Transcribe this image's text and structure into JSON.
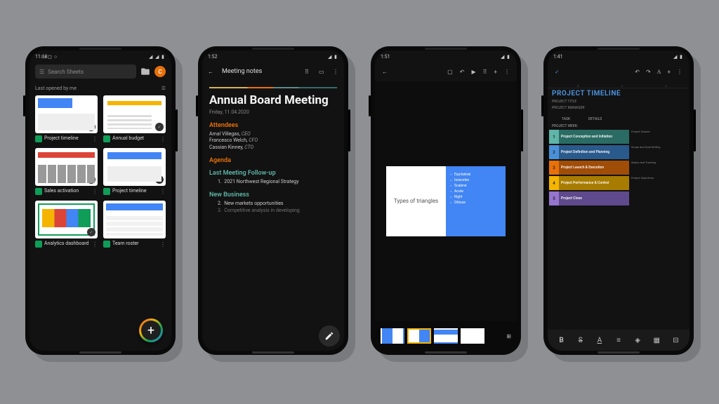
{
  "phone1": {
    "time": "11:18",
    "search_placeholder": "Search Sheets",
    "avatar_letter": "C",
    "sort_label": "Last opened by me",
    "files": [
      {
        "name": "Project timeline"
      },
      {
        "name": "Annual budget"
      },
      {
        "name": "Sales activation"
      },
      {
        "name": "Project timeline"
      },
      {
        "name": "Analytics dashboard"
      },
      {
        "name": "Team roster"
      }
    ]
  },
  "phone2": {
    "time": "1:52",
    "doc_name": "Meeting notes",
    "title": "Annual Board Meeting",
    "date": "Friday, 11.04.2020",
    "attendees_heading": "Attendees",
    "attendees": [
      {
        "name": "Amal Villegas",
        "role": "CEO"
      },
      {
        "name": "Francesco Welch",
        "role": "CFO"
      },
      {
        "name": "Cassian Kinney",
        "role": "CTO"
      }
    ],
    "agenda_heading": "Agenda",
    "sub1": "Last Meeting Follow-up",
    "item1": "2021 Northwest Regional Strategy",
    "sub2": "New Business",
    "item2": "New markets opportunities",
    "item3": "Competitive analysis in developing"
  },
  "phone3": {
    "time": "1:51",
    "slide_title": "Types of triangles",
    "bullets": [
      "Equilateral",
      "Isosceles",
      "Scalene",
      "Acute",
      "Right",
      "Obtuse"
    ]
  },
  "phone4": {
    "time": "1:41",
    "title": "PROJECT TIMELINE",
    "label1": "PROJECT TITLE",
    "label2": "PROJECT MANAGER",
    "col1": "TASK",
    "col2": "DETAILS",
    "week_label": "PROJECT WEEK:",
    "phases": [
      {
        "n": "1",
        "name": "Project Conception and Initiation",
        "d": "Project Charter"
      },
      {
        "n": "2",
        "name": "Project Definition and Planning",
        "d": "Scope and Goal Setting"
      },
      {
        "n": "3",
        "name": "Project Launch & Execution",
        "d": "Status and Tracking"
      },
      {
        "n": "4",
        "name": "Project Performance & Control",
        "d": "Project Objectives"
      },
      {
        "n": "5",
        "name": "Project Close",
        "d": ""
      }
    ]
  }
}
